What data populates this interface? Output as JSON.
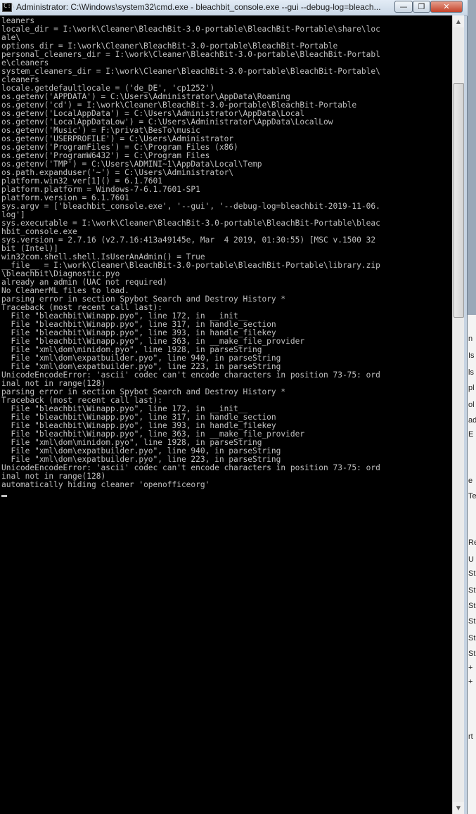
{
  "window": {
    "title": "Administrator: C:\\Windows\\system32\\cmd.exe - bleachbit_console.exe  --gui --debug-log=bleach...",
    "minimize_glyph": "—",
    "maximize_glyph": "❐",
    "close_glyph": "✕",
    "app_icon_prompt": "C:\\"
  },
  "console": {
    "lines": [
      "leaners",
      "locale_dir = I:\\work\\Cleaner\\BleachBit-3.0-portable\\BleachBit-Portable\\share\\loc",
      "ale\\",
      "options_dir = I:\\work\\Cleaner\\BleachBit-3.0-portable\\BleachBit-Portable",
      "personal_cleaners_dir = I:\\work\\Cleaner\\BleachBit-3.0-portable\\BleachBit-Portabl",
      "e\\cleaners",
      "system_cleaners_dir = I:\\work\\Cleaner\\BleachBit-3.0-portable\\BleachBit-Portable\\",
      "cleaners",
      "locale.getdefaultlocale = ('de_DE', 'cp1252')",
      "os.getenv('APPDATA') = C:\\Users\\Administrator\\AppData\\Roaming",
      "os.getenv('cd') = I:\\work\\Cleaner\\BleachBit-3.0-portable\\BleachBit-Portable",
      "os.getenv('LocalAppData') = C:\\Users\\Administrator\\AppData\\Local",
      "os.getenv('LocalAppDataLow') = C:\\Users\\Administrator\\AppData\\LocalLow",
      "os.getenv('Music') = F:\\privat\\BesTo\\music",
      "os.getenv('USERPROFILE') = C:\\Users\\Administrator",
      "os.getenv('ProgramFiles') = C:\\Program Files (x86)",
      "os.getenv('ProgramW6432') = C:\\Program Files",
      "os.getenv('TMP') = C:\\Users\\ADMINI~1\\AppData\\Local\\Temp",
      "os.path.expanduser('~') = C:\\Users\\Administrator\\",
      "platform.win32_ver[1]() = 6.1.7601",
      "platform.platform = Windows-7-6.1.7601-SP1",
      "platform.version = 6.1.7601",
      "sys.argv = ['bleachbit_console.exe', '--gui', '--debug-log=bleachbit-2019-11-06.",
      "log']",
      "sys.executable = I:\\work\\Cleaner\\BleachBit-3.0-portable\\BleachBit-Portable\\bleac",
      "hbit_console.exe",
      "sys.version = 2.7.16 (v2.7.16:413a49145e, Mar  4 2019, 01:30:55) [MSC v.1500 32",
      "bit (Intel)]",
      "win32com.shell.shell.IsUserAnAdmin() = True",
      "__file__ = I:\\work\\Cleaner\\BleachBit-3.0-portable\\BleachBit-Portable\\library.zip",
      "\\bleachbit\\Diagnostic.pyo",
      "already an admin (UAC not required)",
      "No CleanerML files to load.",
      "parsing error in section Spybot Search and Destroy History *",
      "Traceback (most recent call last):",
      "  File \"bleachbit\\Winapp.pyo\", line 172, in __init__",
      "  File \"bleachbit\\Winapp.pyo\", line 317, in handle_section",
      "  File \"bleachbit\\Winapp.pyo\", line 393, in handle_filekey",
      "  File \"bleachbit\\Winapp.pyo\", line 363, in __make_file_provider",
      "  File \"xml\\dom\\minidom.pyo\", line 1928, in parseString",
      "  File \"xml\\dom\\expatbuilder.pyo\", line 940, in parseString",
      "  File \"xml\\dom\\expatbuilder.pyo\", line 223, in parseString",
      "UnicodeEncodeError: 'ascii' codec can't encode characters in position 73-75: ord",
      "inal not in range(128)",
      "parsing error in section Spybot Search and Destroy History *",
      "Traceback (most recent call last):",
      "  File \"bleachbit\\Winapp.pyo\", line 172, in __init__",
      "  File \"bleachbit\\Winapp.pyo\", line 317, in handle_section",
      "  File \"bleachbit\\Winapp.pyo\", line 393, in handle_filekey",
      "  File \"bleachbit\\Winapp.pyo\", line 363, in __make_file_provider",
      "  File \"xml\\dom\\minidom.pyo\", line 1928, in parseString",
      "  File \"xml\\dom\\expatbuilder.pyo\", line 940, in parseString",
      "  File \"xml\\dom\\expatbuilder.pyo\", line 223, in parseString",
      "UnicodeEncodeError: 'ascii' codec can't encode characters in position 73-75: ord",
      "inal not in range(128)",
      "automatically hiding cleaner 'openofficeorg'"
    ]
  },
  "scrollbar": {
    "up_glyph": "▲",
    "down_glyph": "▼"
  },
  "background_window": {
    "fragments": [
      "n",
      "Is",
      "ls",
      "pl",
      "ol",
      "ad",
      "E",
      "e",
      "Te",
      "Re",
      "U",
      "St",
      "St",
      "St",
      "St",
      "St",
      "St",
      "+",
      "+",
      "rt"
    ]
  },
  "colors": {
    "console_background": "#000000",
    "console_text": "#c0c0c0",
    "close_button": "#c4432a",
    "titlebar": "#c9d7e6"
  }
}
